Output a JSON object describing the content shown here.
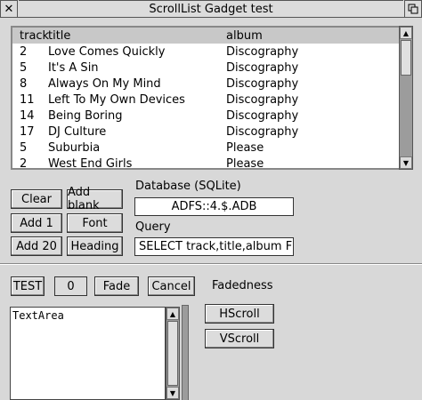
{
  "window": {
    "title": "ScrollList Gadget test"
  },
  "list": {
    "headers": {
      "track": "track",
      "title": "title",
      "album": "album"
    },
    "rows": [
      {
        "track": "2",
        "title": "Love Comes Quickly",
        "album": "Discography"
      },
      {
        "track": "5",
        "title": "It's A Sin",
        "album": "Discography"
      },
      {
        "track": "8",
        "title": "Always On My Mind",
        "album": "Discography"
      },
      {
        "track": "11",
        "title": "Left To My Own Devices",
        "album": "Discography"
      },
      {
        "track": "14",
        "title": "Being Boring",
        "album": "Discography"
      },
      {
        "track": "17",
        "title": "DJ Culture",
        "album": "Discography"
      },
      {
        "track": "5",
        "title": "Suburbia",
        "album": "Please"
      },
      {
        "track": "2",
        "title": "West End Girls",
        "album": "Please"
      }
    ]
  },
  "buttons": {
    "clear": "Clear",
    "add_blank": "Add blank",
    "add1": "Add 1",
    "font": "Font",
    "add20": "Add 20",
    "heading": "Heading",
    "test": "TEST",
    "fade": "Fade",
    "cancel": "Cancel",
    "hscroll": "HScroll",
    "vscroll": "VScroll"
  },
  "database": {
    "label": "Database (SQLite)",
    "value": "ADFS::4.$.ADB"
  },
  "query": {
    "label": "Query",
    "value": "SELECT track,title,album FRO"
  },
  "counter": {
    "value": "0"
  },
  "fadedness": {
    "label": "Fadedness"
  },
  "textarea": {
    "value": "TextArea"
  }
}
